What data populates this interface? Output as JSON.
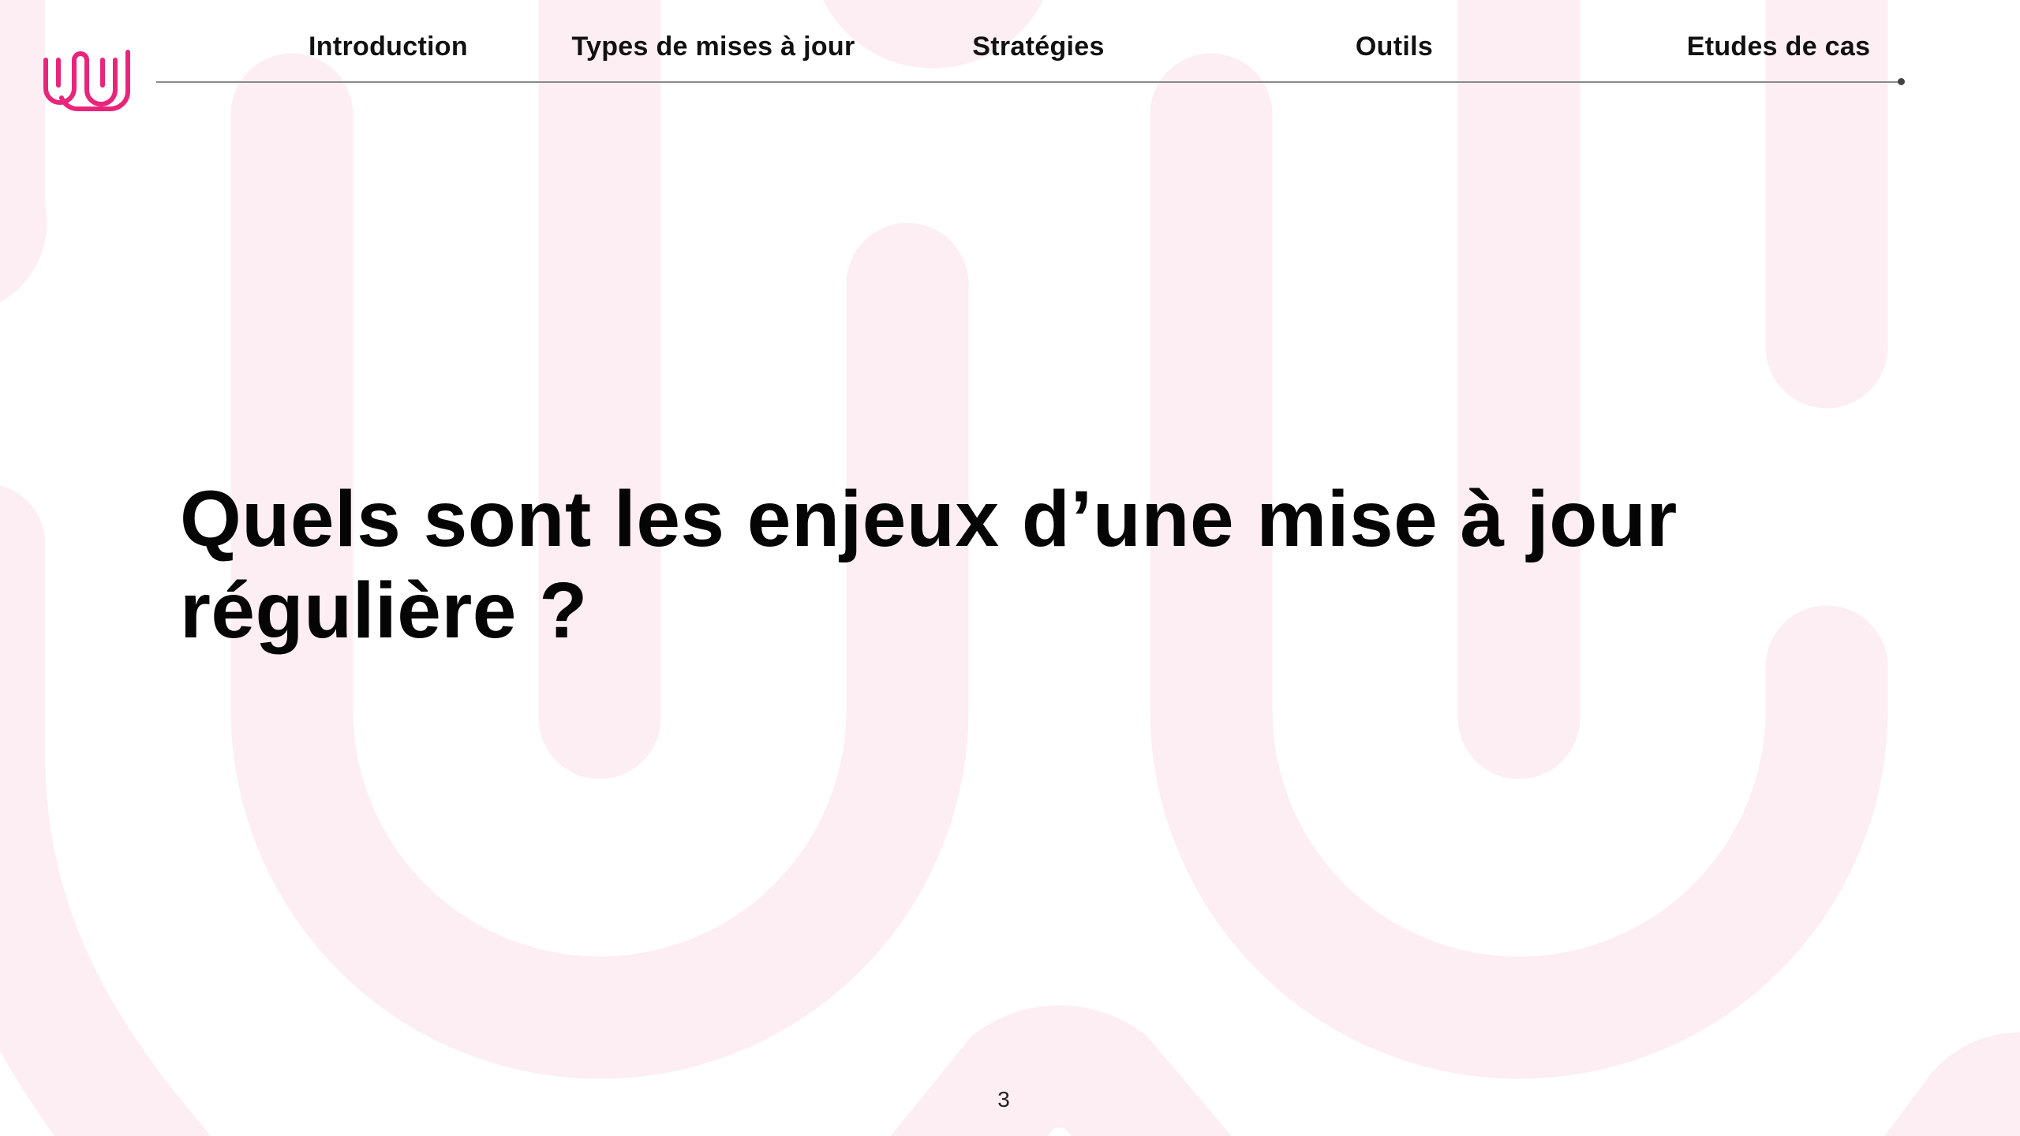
{
  "nav": {
    "items": [
      {
        "label": "Introduction"
      },
      {
        "label": "Types de mises à jour"
      },
      {
        "label": "Stratégies"
      },
      {
        "label": "Outils"
      },
      {
        "label": "Etudes de cas"
      }
    ]
  },
  "slide": {
    "title_line1": "Quels sont les enjeux d’une mise à jour",
    "title_line2": "régulière ?",
    "page_number": "3"
  },
  "icons": {
    "logo": "brand-wave-logo-icon"
  },
  "colors": {
    "brand": "#e8257a",
    "background_pattern": "#fdeef3",
    "text": "#050505",
    "divider": "#8a8a8a"
  }
}
